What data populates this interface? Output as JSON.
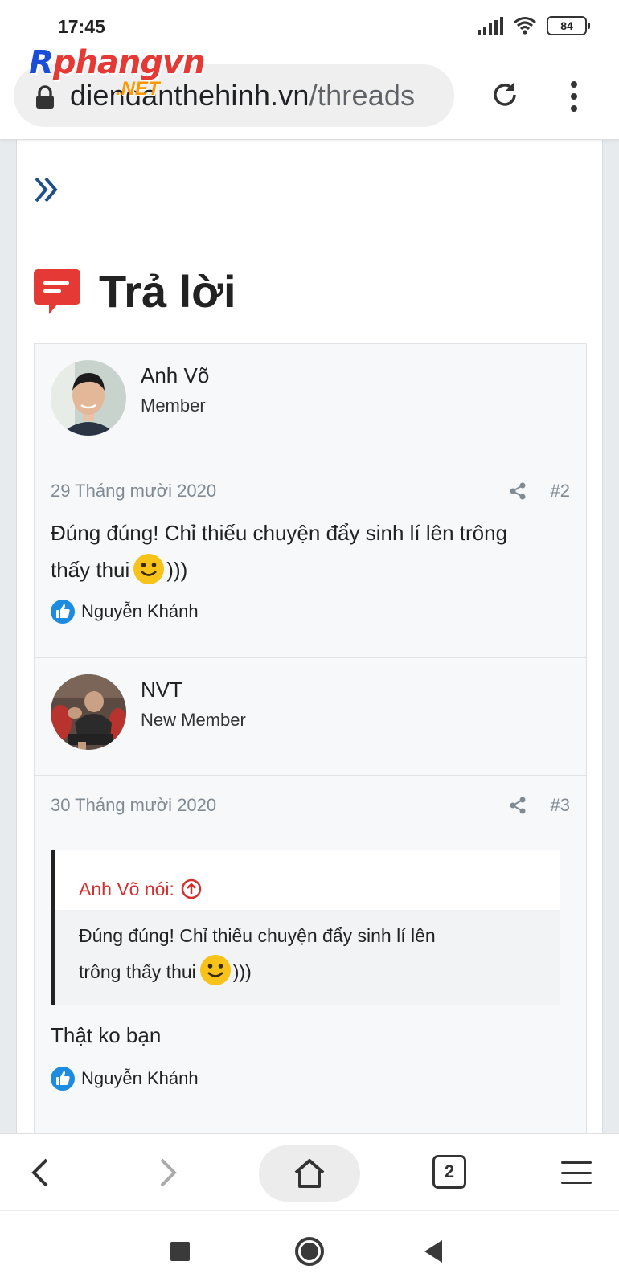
{
  "status_bar": {
    "time": "17:45",
    "battery": "84"
  },
  "browser": {
    "url_domain": "diendanthehinh.vn",
    "url_path": "/threads",
    "tab_count": "2"
  },
  "watermark": {
    "main_r": "R",
    "main_rest": "phangvn",
    "suffix": ".NET"
  },
  "page": {
    "section_title": "Trả lời"
  },
  "posts": [
    {
      "username": "Anh Võ",
      "user_title": "Member",
      "date": "29 Tháng mười 2020",
      "number": "#2",
      "text_line1": "Đúng đúng! Chỉ thiếu chuyện đẩy sinh lí lên trông",
      "text_line2_pre": "thấy thui",
      "text_line2_post": ")))",
      "liked_by": "Nguyễn Khánh"
    },
    {
      "username": "NVT",
      "user_title": "New Member",
      "date": "30 Tháng mười 2020",
      "number": "#3",
      "quote": {
        "author_said": "Anh Võ nói:",
        "line1": "Đúng đúng! Chỉ thiếu chuyện đẩy sinh lí lên",
        "line2_pre": "trông thấy thui",
        "line2_post": ")))"
      },
      "text": "Thật ko bạn",
      "liked_by": "Nguyễn Khánh"
    }
  ],
  "colors": {
    "accent_red": "#e53935",
    "quote_red": "#d32f2f",
    "link_blue": "#1e4e8c",
    "like_blue": "#1d8ce0",
    "muted": "#7f8a93"
  },
  "icons": [
    "lock-icon",
    "reload-icon",
    "more-icon",
    "chevrons-icon",
    "reply-icon",
    "share-icon",
    "like-icon",
    "smile-emoji-icon",
    "arrow-up-circle-icon",
    "back-icon",
    "forward-icon",
    "home-icon",
    "tabs-icon",
    "menu-icon"
  ]
}
